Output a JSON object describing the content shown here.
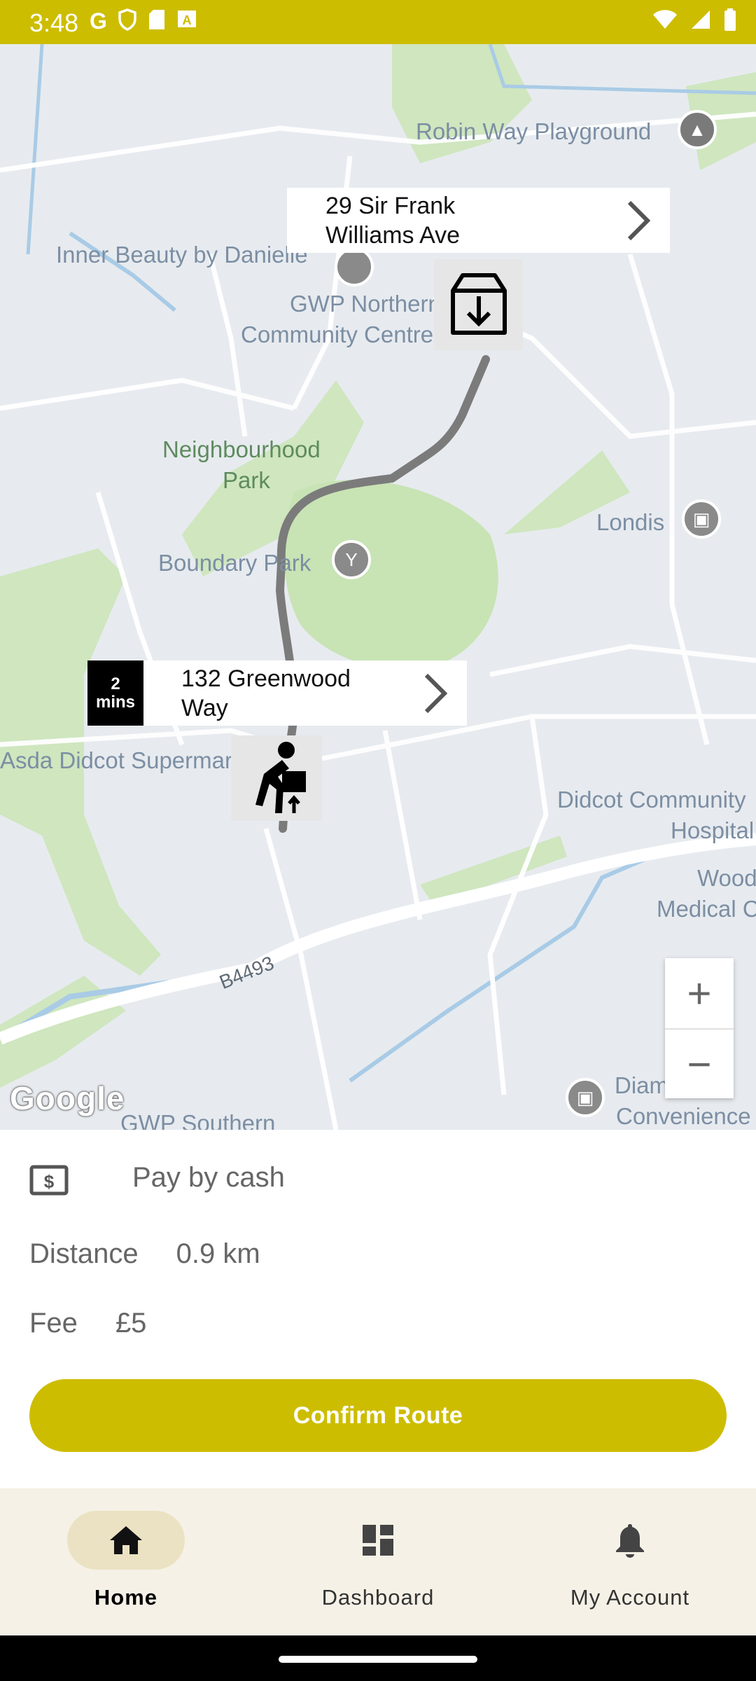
{
  "status_bar": {
    "time": "3:48",
    "left_icons": [
      "google-icon",
      "shield-icon",
      "sd-card-icon",
      "font-icon"
    ],
    "right_icons": [
      "wifi-icon",
      "signal-icon",
      "battery-icon"
    ]
  },
  "map": {
    "labels": {
      "robin_way": "Robin Way Playground",
      "inner_beauty": "Inner Beauty by Danielle",
      "gwp_northern": "GWP Northern",
      "community_centre": "Community Centre",
      "neighbourhood_1": "Neighbourhood",
      "neighbourhood_2": "Park",
      "boundary_park": "Boundary Park",
      "londis": "Londis",
      "asda": "Asda Didcot Supermarket",
      "didcot_community": "Didcot Community",
      "hospital": "Hospital",
      "wood": "Wood",
      "medical": "Medical C",
      "b4493": "B4493",
      "diamond": "Diamond",
      "convenience": "Convenience",
      "gwp_southern": "GWP Southern"
    },
    "destination": {
      "line1": "29 Sir Frank",
      "line2": "Williams Ave"
    },
    "origin": {
      "eta_number": "2",
      "eta_unit": "mins",
      "line1": "132 Greenwood",
      "line2": "Way"
    },
    "zoom_in": "+",
    "zoom_out": "−",
    "logo": "Google"
  },
  "sheet": {
    "payment": "Pay by cash",
    "distance_label": "Distance",
    "distance_value": "0.9 km",
    "fee_label": "Fee",
    "fee_value": "£5",
    "confirm_label": "Confirm Route"
  },
  "nav": {
    "items": [
      {
        "label": "Home",
        "icon": "home-icon",
        "active": true
      },
      {
        "label": "Dashboard",
        "icon": "dashboard-icon",
        "active": false
      },
      {
        "label": "My Account",
        "icon": "bell-icon",
        "active": false
      }
    ]
  },
  "colors": {
    "brand": "#cdbd00",
    "nav_bg": "#f6f1e6",
    "route": "#7b7b7b"
  }
}
